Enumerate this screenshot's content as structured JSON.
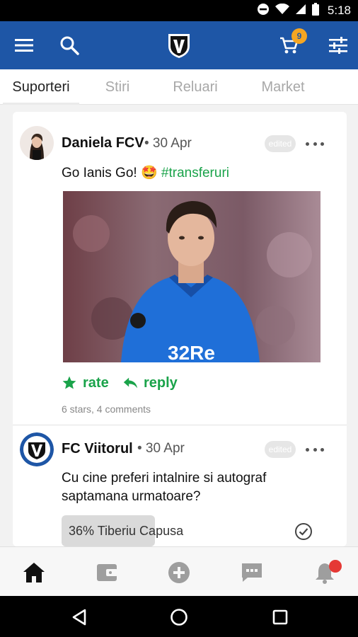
{
  "status_bar": {
    "time": "5:18",
    "icons": [
      "do-not-disturb-icon",
      "wifi-icon",
      "signal-icon",
      "battery-icon"
    ]
  },
  "app_bar": {
    "menu_icon": "menu-icon",
    "search_icon": "search-icon",
    "logo": "FC Viitorul crest",
    "cart_icon": "cart-icon",
    "cart_count": "9",
    "filter_icon": "tune-icon"
  },
  "tabs": [
    {
      "label": "Suporteri",
      "active": true
    },
    {
      "label": "Stiri",
      "active": false
    },
    {
      "label": "Reluari",
      "active": false
    },
    {
      "label": "Market",
      "active": false
    }
  ],
  "posts": [
    {
      "author": "Daniela FCV",
      "date": "• 30 Apr",
      "edited_label": "edited",
      "text": "Go Ianis Go!",
      "emoji": "🤩",
      "hashtag": "#transferuri",
      "image": "football player in blue jersey",
      "image_jersey_text": "32Re",
      "actions": {
        "rate": "rate",
        "reply": "reply"
      },
      "stats": "6 stars, 4 comments"
    },
    {
      "author": "FC Viitorul",
      "date": "• 30 Apr",
      "edited_label": "edited",
      "text_line1": "Cu cine preferi intalnire si autograf",
      "text_line2": "saptamana urmatoare?",
      "poll_option": "36% Tiberiu Capusa"
    }
  ],
  "bottom_nav": [
    {
      "icon": "home-icon",
      "active": true
    },
    {
      "icon": "wallet-icon",
      "active": false
    },
    {
      "icon": "add-circle-icon",
      "active": false
    },
    {
      "icon": "chat-icon",
      "active": false
    },
    {
      "icon": "bell-icon",
      "active": false,
      "has_badge": true
    }
  ],
  "colors": {
    "primary": "#1e56a6",
    "accent_green": "#1aa34a",
    "badge_orange": "#f5a623",
    "notification_red": "#e53935"
  }
}
